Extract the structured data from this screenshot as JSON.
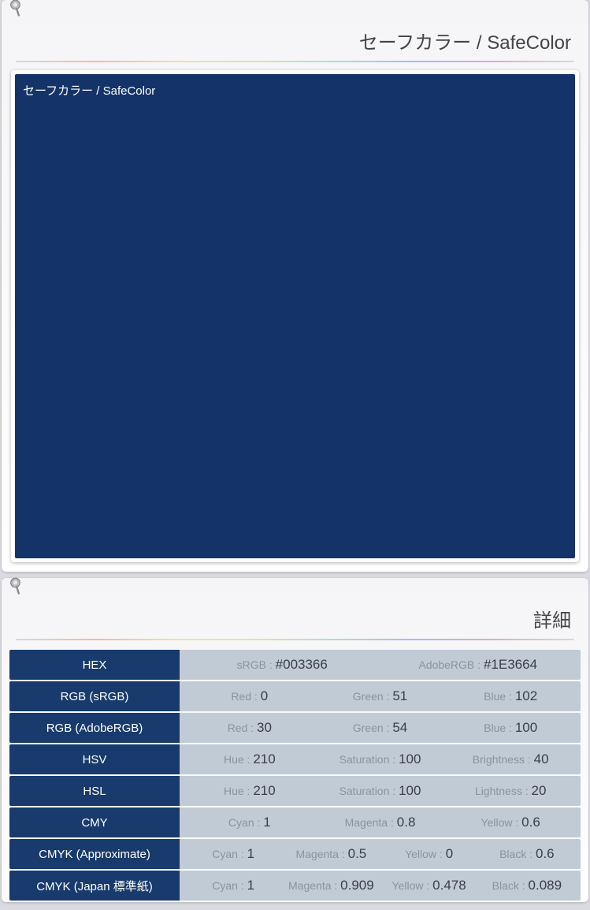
{
  "swatch_color": "#143469",
  "header_bg": "#183a6c",
  "panel1": {
    "title": "セーフカラー / SafeColor",
    "swatch_label": "セーフカラー / SafeColor"
  },
  "panel2": {
    "title": "詳細",
    "rows": [
      {
        "label": "HEX",
        "cells": [
          {
            "k": "sRGB : ",
            "v": "#003366"
          },
          {
            "k": "AdobeRGB : ",
            "v": "#1E3664"
          }
        ]
      },
      {
        "label": "RGB (sRGB)",
        "cells": [
          {
            "k": "Red : ",
            "v": "0"
          },
          {
            "k": "Green : ",
            "v": "51"
          },
          {
            "k": "Blue : ",
            "v": "102"
          }
        ]
      },
      {
        "label": "RGB (AdobeRGB)",
        "cells": [
          {
            "k": "Red : ",
            "v": "30"
          },
          {
            "k": "Green : ",
            "v": "54"
          },
          {
            "k": "Blue : ",
            "v": "100"
          }
        ]
      },
      {
        "label": "HSV",
        "cells": [
          {
            "k": "Hue : ",
            "v": "210"
          },
          {
            "k": "Saturation : ",
            "v": "100"
          },
          {
            "k": "Brightness : ",
            "v": "40"
          }
        ]
      },
      {
        "label": "HSL",
        "cells": [
          {
            "k": "Hue : ",
            "v": "210"
          },
          {
            "k": "Saturation : ",
            "v": "100"
          },
          {
            "k": "Lightness : ",
            "v": "20"
          }
        ]
      },
      {
        "label": "CMY",
        "cells": [
          {
            "k": "Cyan : ",
            "v": "1"
          },
          {
            "k": "Magenta : ",
            "v": "0.8"
          },
          {
            "k": "Yellow : ",
            "v": "0.6"
          }
        ]
      },
      {
        "label": "CMYK (Approximate)",
        "cells": [
          {
            "k": "Cyan : ",
            "v": "1"
          },
          {
            "k": "Magenta : ",
            "v": "0.5"
          },
          {
            "k": "Yellow : ",
            "v": "0"
          },
          {
            "k": "Black : ",
            "v": "0.6"
          }
        ]
      },
      {
        "label": "CMYK (Japan 標準紙)",
        "cells": [
          {
            "k": "Cyan : ",
            "v": "1"
          },
          {
            "k": "Magenta : ",
            "v": "0.909"
          },
          {
            "k": "Yellow : ",
            "v": "0.478"
          },
          {
            "k": "Black : ",
            "v": "0.089"
          }
        ]
      }
    ]
  }
}
